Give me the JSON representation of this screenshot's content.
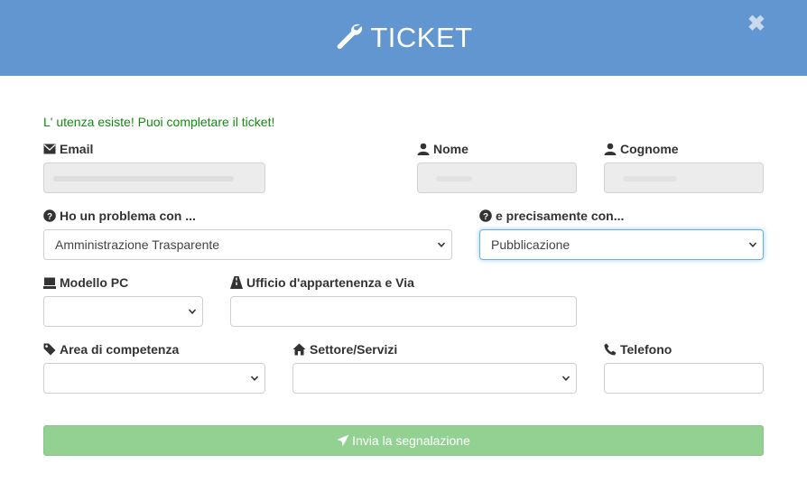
{
  "dialog": {
    "title": "TICKET",
    "header_color": "#6296d1",
    "close_glyph": "✖"
  },
  "form": {
    "status_message": "L' utenza esiste! Puoi completare il ticket!",
    "email": {
      "label": "Email",
      "value": ""
    },
    "nome": {
      "label": "Nome",
      "value": ""
    },
    "cognome": {
      "label": "Cognome",
      "value": ""
    },
    "problema": {
      "label": "Ho un problema con ...",
      "selected": "Amministrazione Trasparente"
    },
    "precisamente": {
      "label": "e precisamente con...",
      "selected": "Pubblicazione"
    },
    "modello_pc": {
      "label": "Modello PC",
      "selected": ""
    },
    "ufficio": {
      "label": "Ufficio d'appartenenza e Via",
      "value": ""
    },
    "area": {
      "label": "Area di competenza",
      "selected": ""
    },
    "settore": {
      "label": "Settore/Servizi",
      "selected": ""
    },
    "telefono": {
      "label": "Telefono",
      "value": ""
    },
    "submit_label": "Invia la segnalazione"
  },
  "icons": {
    "title": "wrench-icon",
    "email": "envelope-icon",
    "nome": "user-icon",
    "cognome": "user-icon",
    "problema": "question-circle-icon",
    "precisamente": "question-circle-icon",
    "modello_pc": "laptop-icon",
    "ufficio": "road-icon",
    "area": "tag-icon",
    "settore": "home-icon",
    "telefono": "phone-icon",
    "submit": "send-icon",
    "close": "close-icon"
  },
  "colors": {
    "success_text": "#138a13",
    "submit_button": "#92d192",
    "focus_border": "#66afe9"
  }
}
